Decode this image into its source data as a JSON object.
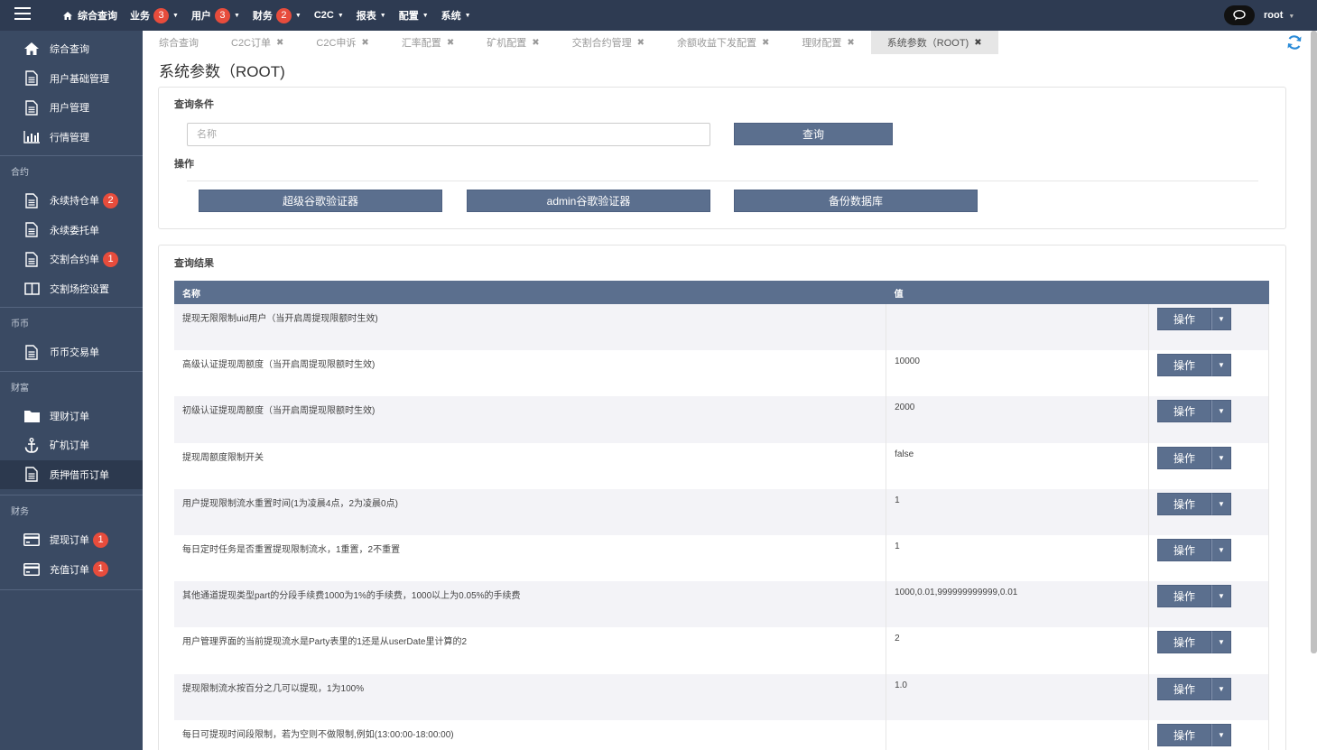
{
  "topbar": {
    "menu_items": [
      {
        "label": "综合查询",
        "badge": "",
        "has_caret": false,
        "icon": "home-icon"
      },
      {
        "label": "业务",
        "badge": "3",
        "has_caret": true
      },
      {
        "label": "用户",
        "badge": "3",
        "has_caret": true
      },
      {
        "label": "财务",
        "badge": "2",
        "has_caret": true
      },
      {
        "label": "C2C",
        "badge": "",
        "has_caret": true
      },
      {
        "label": "报表",
        "badge": "",
        "has_caret": true
      },
      {
        "label": "配置",
        "badge": "",
        "has_caret": true
      },
      {
        "label": "系统",
        "badge": "",
        "has_caret": true
      }
    ],
    "user": "root"
  },
  "sidebar": {
    "group0": [
      {
        "label": "综合查询",
        "icon": "home-icon"
      },
      {
        "label": "用户基础管理",
        "icon": "document-icon"
      },
      {
        "label": "用户管理",
        "icon": "document-icon"
      },
      {
        "label": "行情管理",
        "icon": "bar-chart-icon"
      }
    ],
    "section_contract": "合约",
    "group1": [
      {
        "label": "永续持仓单",
        "badge": "2",
        "icon": "document-icon"
      },
      {
        "label": "永续委托单",
        "badge": "",
        "icon": "document-icon"
      },
      {
        "label": "交割合约单",
        "badge": "1",
        "icon": "document-icon"
      },
      {
        "label": "交割场控设置",
        "badge": "",
        "icon": "columns-icon"
      }
    ],
    "section_coin": "币币",
    "group2": [
      {
        "label": "币币交易单",
        "icon": "document-icon"
      }
    ],
    "section_wealth": "财富",
    "group3": [
      {
        "label": "理财订单",
        "icon": "folder-icon"
      },
      {
        "label": "矿机订单",
        "icon": "anchor-icon"
      },
      {
        "label": "质押借币订单",
        "icon": "document-icon"
      }
    ],
    "section_finance": "财务",
    "group4": [
      {
        "label": "提现订单",
        "badge": "1",
        "icon": "card-icon"
      },
      {
        "label": "充值订单",
        "badge": "1",
        "icon": "card-icon"
      }
    ]
  },
  "tabs": [
    {
      "label": "综合查询",
      "closable": false
    },
    {
      "label": "C2C订单",
      "closable": true
    },
    {
      "label": "C2C申诉",
      "closable": true
    },
    {
      "label": "汇率配置",
      "closable": true
    },
    {
      "label": "矿机配置",
      "closable": true
    },
    {
      "label": "交割合约管理",
      "closable": true
    },
    {
      "label": "余额收益下发配置",
      "closable": true
    },
    {
      "label": "理财配置",
      "closable": true
    },
    {
      "label": "系统参数（ROOT)",
      "closable": true,
      "active": true
    }
  ],
  "page": {
    "title": "系统参数（ROOT)",
    "query_panel": {
      "title": "查询条件",
      "name_placeholder": "名称",
      "search_button": "查询",
      "ops_title": "操作",
      "buttons": [
        "超级谷歌验证器",
        "admin谷歌验证器",
        "备份数据库"
      ]
    },
    "results": {
      "title": "查询结果",
      "columns": [
        "名称",
        "值",
        ""
      ],
      "action_label": "操作",
      "rows": [
        {
          "name": "提现无限限制uid用户（当开启周提现限额时生效)",
          "value": ""
        },
        {
          "name": "高级认证提现周额度（当开启周提现限额时生效)",
          "value": "10000"
        },
        {
          "name": "初级认证提现周额度（当开启周提现限额时生效)",
          "value": "2000"
        },
        {
          "name": "提现周额度限制开关",
          "value": "false"
        },
        {
          "name": "用户提现限制流水重置时间(1为凌晨4点，2为凌晨0点)",
          "value": "1"
        },
        {
          "name": "每日定时任务是否重置提现限制流水，1重置，2不重置",
          "value": "1"
        },
        {
          "name": "其他通道提现类型part的分段手续费1000为1%的手续费，1000以上为0.05%的手续费",
          "value": "1000,0.01,999999999999,0.01"
        },
        {
          "name": "用户管理界面的当前提现流水是Party表里的1还是从userDate里计算的2",
          "value": "2"
        },
        {
          "name": "提现限制流水按百分之几可以提现，1为100%",
          "value": "1.0"
        },
        {
          "name": "每日可提现时间段限制，若为空则不做限制,例如(13:00:00-18:00:00)",
          "value": ""
        }
      ]
    }
  },
  "colors": {
    "topbar": "#2e3b52",
    "sidebar": "#3a4a63",
    "button": "#5b6f8e",
    "badge": "#e74c3c"
  }
}
